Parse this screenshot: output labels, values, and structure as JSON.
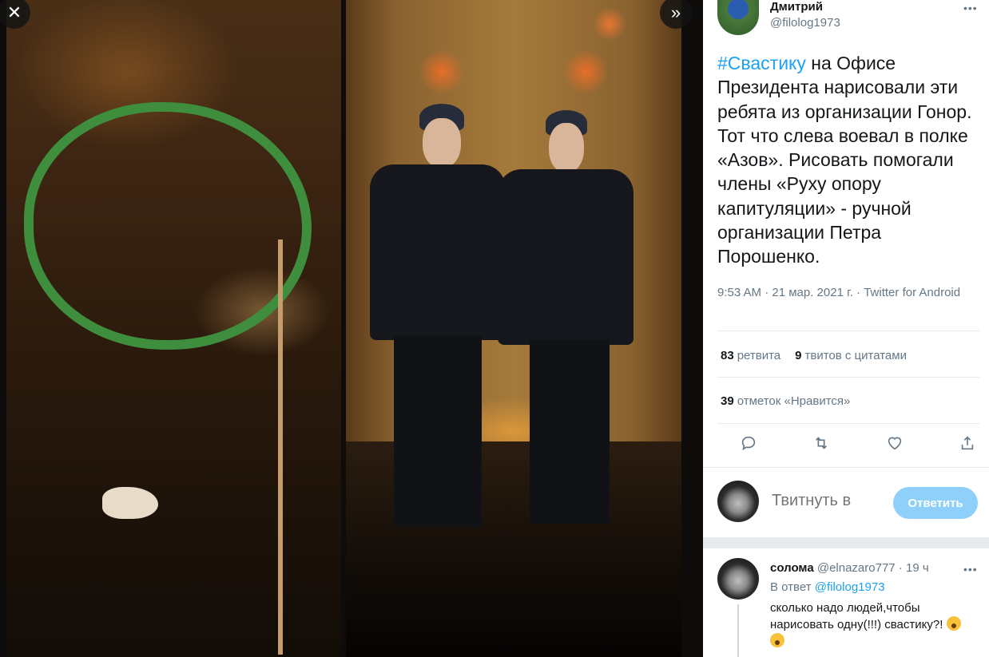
{
  "viewer": {
    "close_glyph": "✕",
    "next_glyph": "»"
  },
  "tweet": {
    "author_name": "Дмитрий",
    "author_handle": "@filolog1973",
    "hashtag": "#Свастику",
    "body": " на Офисе Президента нарисовали эти ребята из организации Гонор. Тот что слева воевал в полке «Азов». Рисовать помогали члены «Руху опору капитуляции» - ручной организации Петра Порошенко.",
    "meta": "9:53 AM · 21 мар. 2021 г. · Twitter for Android",
    "retweets_count": "83",
    "retweets_label": "ретвита",
    "quotes_count": "9",
    "quotes_label": "твитов с цитатами",
    "likes_count": "39",
    "likes_label": "отметок «Нравится»",
    "more_glyph": "•••"
  },
  "reply_box": {
    "placeholder": "Твитнуть в",
    "button_label": "Ответить"
  },
  "reply": {
    "author_name": "солома",
    "author_handle": "@elnazaro777",
    "time": " · 19 ч",
    "reply_to_prefix": "В ответ ",
    "reply_to_handle": "@filolog1973",
    "text": "сколько надо людей,чтобы нарисовать одну(!!!) свастику?!"
  }
}
